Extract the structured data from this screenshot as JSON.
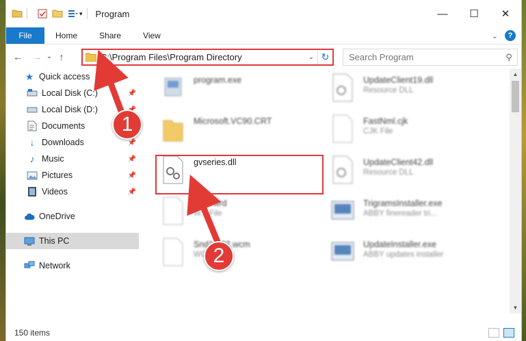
{
  "window": {
    "title": "Program",
    "controls": {
      "minimize": "—",
      "maximize": "☐",
      "close": "✕"
    }
  },
  "ribbon": {
    "tabs": [
      "File",
      "Home",
      "Share",
      "View"
    ],
    "help": "?"
  },
  "address_bar": {
    "path": "C:\\Program Files\\Program Directory",
    "dropdown": "⌄",
    "refresh": "↻"
  },
  "search": {
    "placeholder": "Search Program"
  },
  "nav": {
    "back": "←",
    "forward": "→",
    "dropdown": "⌄",
    "up": "↑"
  },
  "navpane": {
    "quick_access": "Quick access",
    "items": [
      {
        "label": "Local Disk (C:)",
        "icon": "drive-icon",
        "pinned": true
      },
      {
        "label": "Local Disk (D:)",
        "icon": "drive-icon",
        "pinned": true
      },
      {
        "label": "Documents",
        "icon": "documents-icon",
        "pinned": true
      },
      {
        "label": "Downloads",
        "icon": "downloads-icon",
        "pinned": true
      },
      {
        "label": "Music",
        "icon": "music-icon",
        "pinned": true
      },
      {
        "label": "Pictures",
        "icon": "pictures-icon",
        "pinned": true
      },
      {
        "label": "Videos",
        "icon": "videos-icon",
        "pinned": true
      }
    ],
    "onedrive": "OneDrive",
    "this_pc": "This PC",
    "network": "Network"
  },
  "files": {
    "left": [
      {
        "name": "program.exe",
        "desc": ""
      },
      {
        "name": "Microsoft.VC90.CRT",
        "desc": ""
      },
      {
        "name": "gvseries.dll",
        "desc": ""
      },
      {
        "name": "A...c.wrd",
        "desc": "W... File"
      },
      {
        "name": "Snd1...32.wcm",
        "desc": "WC... File"
      }
    ],
    "right": [
      {
        "name": "UpdateClient19.dll",
        "desc": "Resource DLL"
      },
      {
        "name": "FastNml.cjk",
        "desc": "CJK File"
      },
      {
        "name": "UpdateClient42.dll",
        "desc": "Resource DLL"
      },
      {
        "name": "TrigramsInstaller.exe",
        "desc": "ABBY finereader tri..."
      },
      {
        "name": "UpdateInstaller.exe",
        "desc": "ABBY updates installer"
      }
    ]
  },
  "badges": {
    "one": "1",
    "two": "2"
  },
  "status": {
    "items": "150 items"
  },
  "colors": {
    "accent": "#1979ca",
    "highlight": "#e0383a"
  }
}
